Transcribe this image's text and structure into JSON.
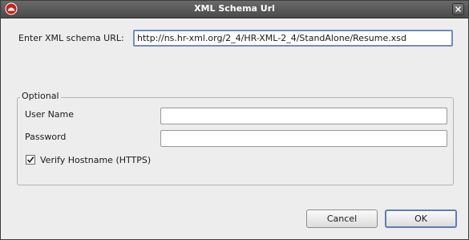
{
  "window": {
    "title": "XML Schema Url",
    "app_icon": "red-hat-logo-icon",
    "close_icon": "close-icon"
  },
  "url_section": {
    "label": "Enter XML schema URL:",
    "value": "http://ns.hr-xml.org/2_4/HR-XML-2_4/StandAlone/Resume.xsd"
  },
  "optional_group": {
    "title": "Optional",
    "username_label": "User Name",
    "username_value": "",
    "password_label": "Password",
    "password_value": "",
    "verify_label": "Verify Hostname (HTTPS)",
    "verify_checked": true
  },
  "buttons": {
    "cancel": "Cancel",
    "ok": "OK"
  }
}
